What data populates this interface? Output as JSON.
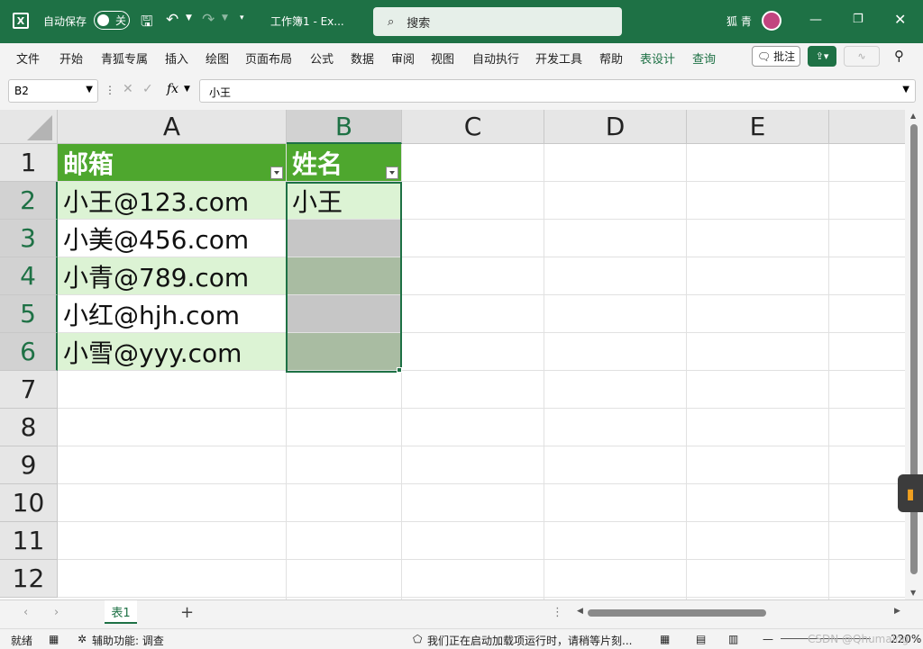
{
  "titlebar": {
    "autosave_label": "自动保存",
    "autosave_state": "关",
    "doc_title": "工作簿1  -  Ex...",
    "search_placeholder": "搜索",
    "user_name": "狐 青"
  },
  "ribbon_tabs": [
    "文件",
    "开始",
    "青狐专属",
    "插入",
    "绘图",
    "页面布局",
    "公式",
    "数据",
    "审阅",
    "视图",
    "自动执行",
    "开发工具",
    "帮助",
    "表设计",
    "查询"
  ],
  "ribbon_buttons": {
    "comments": "批注"
  },
  "formula_bar": {
    "name_box": "B2",
    "formula": "小王",
    "fx_label": "fx"
  },
  "columns": [
    "A",
    "B",
    "C",
    "D",
    "E"
  ],
  "rows": [
    "1",
    "2",
    "3",
    "4",
    "5",
    "6",
    "7",
    "8",
    "9",
    "10",
    "11",
    "12"
  ],
  "table": {
    "headers": [
      "邮箱",
      "姓名"
    ],
    "rows": [
      [
        "小王@123.com",
        "小王"
      ],
      [
        "小美@456.com",
        ""
      ],
      [
        "小青@789.com",
        ""
      ],
      [
        "小红@hjh.com",
        ""
      ],
      [
        "小雪@yyy.com",
        ""
      ]
    ]
  },
  "sheets": [
    "表1"
  ],
  "status": {
    "ready": "就绪",
    "accessibility": "辅助功能: 调查",
    "loading_msg": "我们正在启动加载项运行时，请稍等片刻...",
    "zoom": "220%",
    "watermark": "CSDN @Qhumaing"
  },
  "colors": {
    "accent": "#1e7145",
    "table_header": "#4ea72e",
    "table_band": "#dcf3d4"
  }
}
